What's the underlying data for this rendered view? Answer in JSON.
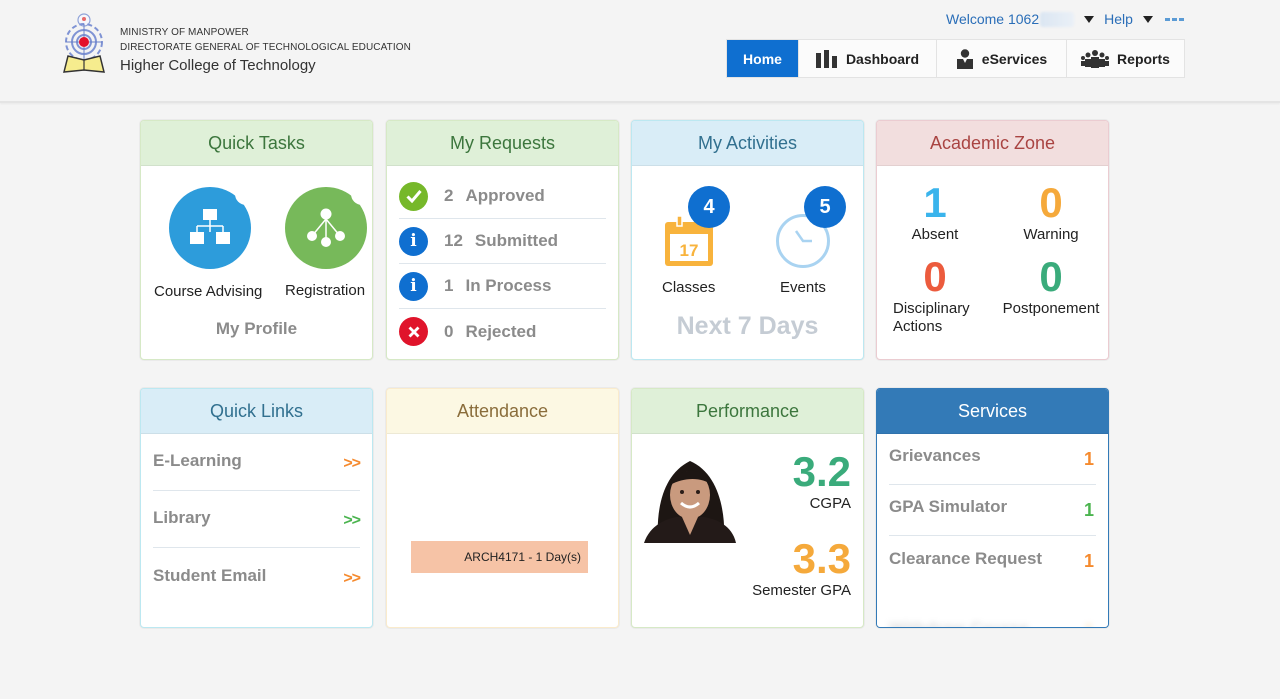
{
  "header": {
    "org_line1": "MINISTRY OF MANPOWER",
    "org_line2": "DIRECTORATE GENERAL OF TECHNOLOGICAL EDUCATION",
    "org_line3": "Higher College of Technology",
    "welcome_label": "Welcome 1062",
    "help_label": "Help",
    "nav": {
      "home": "Home",
      "dashboard": "Dashboard",
      "eservices": "eServices",
      "reports": "Reports"
    },
    "active_tab": "Home",
    "accent_color": "#0f6fd0"
  },
  "cards": {
    "quick_tasks": {
      "title": "Quick Tasks",
      "items": [
        {
          "label": "Course Advising",
          "icon": "sitemap-icon",
          "color": "#2d9cdb"
        },
        {
          "label": "Registration",
          "icon": "hierarchy-icon",
          "color": "#77b95a"
        }
      ],
      "footer": "My Profile"
    },
    "my_requests": {
      "title": "My Requests",
      "items": [
        {
          "count": "2",
          "label": "Approved",
          "icon": "check-circle-icon",
          "status": "ok"
        },
        {
          "count": "12",
          "label": "Submitted",
          "icon": "info-circle-icon",
          "status": "info"
        },
        {
          "count": "1",
          "label": "In Process",
          "icon": "info-circle-icon",
          "status": "info"
        },
        {
          "count": "0",
          "label": "Rejected",
          "icon": "x-circle-icon",
          "status": "no"
        }
      ]
    },
    "my_activities": {
      "title": "My Activities",
      "classes_label": "Classes",
      "classes_count": "4",
      "calendar_day": "17",
      "events_label": "Events",
      "events_count": "5",
      "footer": "Next 7 Days"
    },
    "academic_zone": {
      "title": "Academic Zone",
      "items": [
        {
          "value": "1",
          "label": "Absent",
          "color": "#3ab4ec"
        },
        {
          "value": "0",
          "label": "Warning",
          "color": "#f5a93b"
        },
        {
          "value": "0",
          "label": "Disciplinary Actions",
          "color": "#ec5b3d"
        },
        {
          "value": "0",
          "label": "Postponement",
          "color": "#3aab7b"
        }
      ]
    },
    "quick_links": {
      "title": "Quick Links",
      "items": [
        {
          "label": "E-Learning",
          "arrow": ">>",
          "color": "#f58a2e"
        },
        {
          "label": "Library",
          "arrow": ">>",
          "color": "#4bb44f"
        },
        {
          "label": "Student Email",
          "arrow": ">>",
          "color": "#f58a2e"
        }
      ]
    },
    "attendance": {
      "title": "Attendance",
      "entry": "ARCH4171 - 1 Day(s)"
    },
    "performance": {
      "title": "Performance",
      "cgpa_value": "3.2",
      "cgpa_label": "CGPA",
      "cgpa_color": "#3aab7b",
      "sem_value": "3.3",
      "sem_label": "Semester GPA",
      "sem_color": "#f5a93b"
    },
    "services": {
      "title": "Services",
      "items": [
        {
          "label": "Grievances",
          "count": "1",
          "color": "#f58a2e"
        },
        {
          "label": "GPA Simulator",
          "count": "1",
          "color": "#4bb44f"
        },
        {
          "label": "Clearance Request",
          "count": "1",
          "color": "#f58a2e"
        },
        {
          "label": "Withdraw Course",
          "count": "1",
          "color": "#f58a2e"
        }
      ]
    }
  }
}
